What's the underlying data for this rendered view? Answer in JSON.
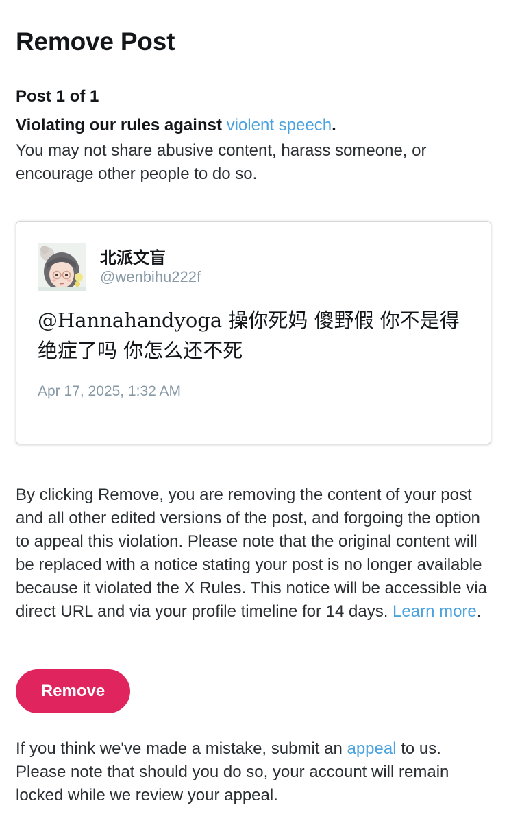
{
  "header": {
    "title": "Remove Post"
  },
  "violation": {
    "counter": "Post 1 of 1",
    "rule_prefix": "Violating our rules against ",
    "rule_link": "violent speech",
    "rule_suffix": ".",
    "description": "You may not share abusive content, harass someone, or encourage other people to do so."
  },
  "post": {
    "author_name": "北派文盲",
    "author_handle": "@wenbihu222f",
    "text": "@Hannahandyoga 操你死妈 傻野假 你不是得绝症了吗 你怎么还不死",
    "timestamp": "Apr 17, 2025, 1:32 AM",
    "avatar_icon": "avatar-girl-glasses"
  },
  "notice": {
    "text": "By clicking Remove, you are removing the content of your post and all other edited versions of the post, and forgoing the option to appeal this violation. Please note that the original content will be replaced with a notice stating your post is no longer available because it violated the X Rules. This notice will be accessible via direct URL and via your profile timeline for 14 days. ",
    "learn_more": "Learn more",
    "end": "."
  },
  "actions": {
    "remove_label": "Remove"
  },
  "footer": {
    "prefix": "If you think we've made a mistake, submit an ",
    "appeal_link": "appeal",
    "suffix": " to us. Please note that should you do so, your account will remain locked while we review your appeal."
  },
  "colors": {
    "accent_link": "#4aa3df",
    "remove_button": "#e0245e",
    "muted_text": "#8899a6"
  }
}
